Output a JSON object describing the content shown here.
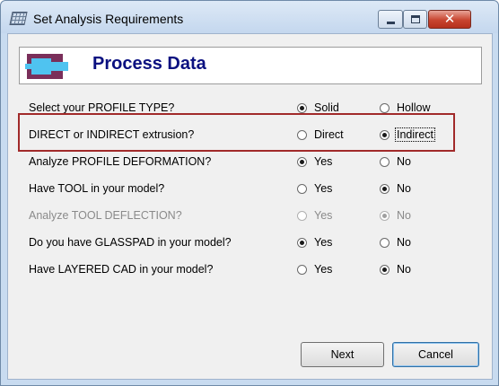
{
  "window": {
    "title": "Set Analysis Requirements"
  },
  "header": {
    "title": "Process Data"
  },
  "questions": [
    {
      "label": "Select your PROFILE TYPE?",
      "options": [
        "Solid",
        "Hollow"
      ],
      "selected": 0,
      "disabled": false
    },
    {
      "label": "DIRECT or INDIRECT extrusion?",
      "options": [
        "Direct",
        "Indirect"
      ],
      "selected": 1,
      "disabled": false
    },
    {
      "label": "Analyze PROFILE DEFORMATION?",
      "options": [
        "Yes",
        "No"
      ],
      "selected": 0,
      "disabled": false
    },
    {
      "label": "Have TOOL in your model?",
      "options": [
        "Yes",
        "No"
      ],
      "selected": 1,
      "disabled": false
    },
    {
      "label": "Analyze TOOL DEFLECTION?",
      "options": [
        "Yes",
        "No"
      ],
      "selected": 1,
      "disabled": true
    },
    {
      "label": "Do you have GLASSPAD in your model?",
      "options": [
        "Yes",
        "No"
      ],
      "selected": 0,
      "disabled": false
    },
    {
      "label": "Have LAYERED CAD in your model?",
      "options": [
        "Yes",
        "No"
      ],
      "selected": 1,
      "disabled": false
    }
  ],
  "buttons": {
    "next": "Next",
    "cancel": "Cancel"
  },
  "colors": {
    "header_title": "#0a1080",
    "highlight_border": "#a12a2a",
    "icon_fill": "#4fc3f0",
    "icon_frame": "#7a2f5a"
  }
}
